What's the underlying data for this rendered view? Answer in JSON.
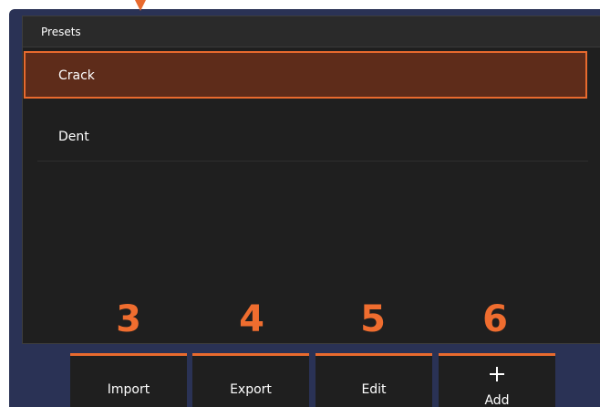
{
  "panel": {
    "title": "Presets"
  },
  "presets": [
    {
      "label": "Crack",
      "selected": true
    },
    {
      "label": "Dent",
      "selected": false
    }
  ],
  "toolbar": {
    "import_label": "Import",
    "export_label": "Export",
    "edit_label": "Edit",
    "add_label": "Add",
    "add_icon": "plus-icon"
  },
  "callouts": {
    "import": "3",
    "export": "4",
    "edit": "5",
    "add": "6"
  },
  "colors": {
    "accent": "#e86a2e",
    "callout": "#ef6d2f",
    "panel_bg": "#1f1f1f",
    "frame_bg": "#2a3255",
    "selected_bg": "#5e2c1a"
  }
}
